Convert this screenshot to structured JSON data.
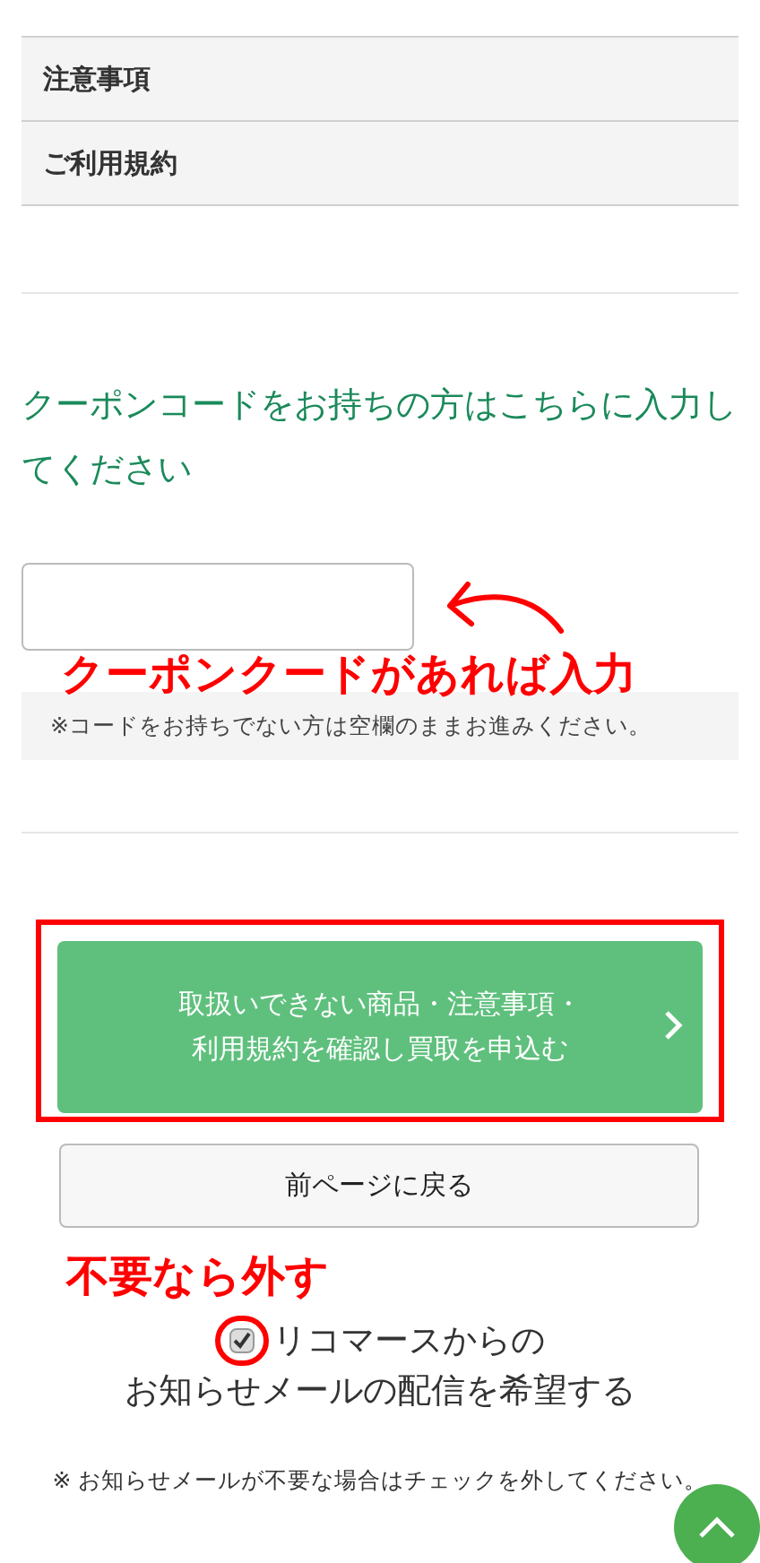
{
  "accordion": [
    {
      "label": "注意事項"
    },
    {
      "label": "ご利用規約"
    }
  ],
  "coupon": {
    "heading": "クーポンコードをお持ちの方はこちらに入力してください",
    "annotation": "クーポンクードがあれば入力",
    "note": "※コードをお持ちでない方は空欄のままお進みください。"
  },
  "submit_button": {
    "label": "取扱いできない商品・注意事項・利用規約を確認し買取を申込む"
  },
  "back_button": {
    "label": "前ページに戻る"
  },
  "newsletter": {
    "annotation": "不要なら外す",
    "checked": true,
    "label_line1": "リコマースからの",
    "label_line2": "お知らせメールの配信を希望する",
    "note": "※ お知らせメールが不要な場合はチェックを外してください。"
  }
}
